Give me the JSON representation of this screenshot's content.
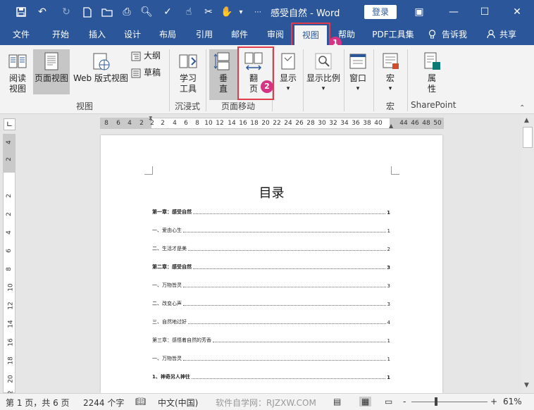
{
  "title_bar": {
    "doc_title": "感受自然 - Word",
    "login_label": "登录"
  },
  "menu": {
    "tabs": [
      "文件",
      "开始",
      "插入",
      "设计",
      "布局",
      "引用",
      "邮件",
      "审阅",
      "视图",
      "帮助",
      "PDF工具集",
      "告诉我",
      "共享"
    ],
    "active": "视图"
  },
  "badges": {
    "first": "1",
    "second": "2"
  },
  "ribbon": {
    "view_group": {
      "read_mode": "阅读\n视图",
      "print_layout": "页面视图",
      "web_layout": "Web 版式视图",
      "outline": "大纲",
      "draft": "草稿",
      "label": "视图"
    },
    "immersive_group": {
      "learning_tools": "学习\n工具",
      "label": "沉浸式"
    },
    "page_movement_group": {
      "vertical": "垂\n直",
      "side_to_side": "翻\n页",
      "label": "页面移动"
    },
    "show": "显示",
    "zoom": "显示比例",
    "window": "窗口",
    "macros": {
      "button": "宏",
      "label": "宏"
    },
    "sharepoint": {
      "properties": "属\n性",
      "label": "SharePoint"
    }
  },
  "ruler": {
    "h_ticks": [
      "8",
      "6",
      "4",
      "2",
      "2",
      "2",
      "4",
      "6",
      "8",
      "10",
      "12",
      "14",
      "16",
      "18",
      "20",
      "22",
      "24",
      "26",
      "28",
      "30",
      "32",
      "34",
      "36",
      "38",
      "40",
      "44",
      "46",
      "48",
      "50"
    ],
    "v_ticks": [
      "4",
      "2",
      "2",
      "2",
      "4",
      "6",
      "8",
      "10",
      "12",
      "14",
      "16",
      "18",
      "20",
      "22"
    ]
  },
  "document": {
    "toc_title": "目录",
    "toc": [
      {
        "text": "第一章：感受自然",
        "page": "1",
        "bold": true
      },
      {
        "text": "一、爱由心生",
        "page": "1",
        "bold": false
      },
      {
        "text": "二、生活才是美",
        "page": "2",
        "bold": false
      },
      {
        "text": "第二章：感受自然",
        "page": "3",
        "bold": true
      },
      {
        "text": "一、万物皆灵",
        "page": "3",
        "bold": false
      },
      {
        "text": "二、改变心声",
        "page": "3",
        "bold": false
      },
      {
        "text": "三、自然地过好",
        "page": "4",
        "bold": false
      },
      {
        "text": "第三章：感悟着自然的芳香",
        "page": "1",
        "bold": false
      },
      {
        "text": "一、万物皆灵",
        "page": "1",
        "bold": false
      },
      {
        "text": "1、神奇另人神往",
        "page": "1",
        "bold": true
      }
    ]
  },
  "status": {
    "page_info": "第 1 页，共 6 页",
    "word_count": "2244 个字",
    "language": "中文(中国)",
    "watermark": "软件自学网：RJZXW.COM",
    "zoom_minus": "-",
    "zoom_plus": "+",
    "zoom": "61%"
  },
  "colors": {
    "brand": "#2b579a",
    "highlight": "#e03c4c",
    "badge": "#d63384"
  }
}
